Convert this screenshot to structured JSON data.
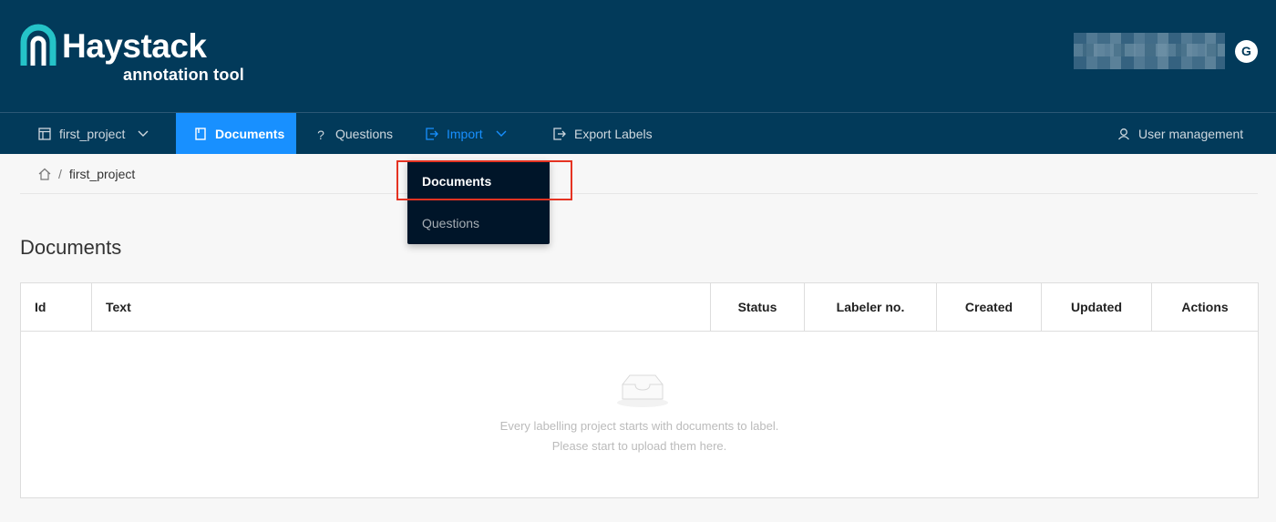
{
  "app": {
    "logo_title": "Haystack",
    "logo_subtitle": "annotation tool",
    "avatar_initial": "G",
    "brand_color": "#023a5a",
    "accent_color": "#1890ff"
  },
  "nav": {
    "project": "first_project",
    "documents": "Documents",
    "questions": "Questions",
    "import": "Import",
    "export_labels": "Export Labels",
    "user_management": "User management"
  },
  "import_menu": {
    "items": [
      {
        "label": "Documents",
        "icon": "none"
      },
      {
        "label": "Questions",
        "icon": "none"
      }
    ]
  },
  "breadcrumb": {
    "home_icon": "home-icon",
    "separator": "/",
    "current": "first_project"
  },
  "page": {
    "title": "Documents"
  },
  "table": {
    "columns": [
      "Id",
      "Text",
      "Status",
      "Labeler no.",
      "Created",
      "Updated",
      "Actions"
    ],
    "rows": [],
    "empty_line1": "Every labelling project starts with documents to label.",
    "empty_line2": "Please start to upload them here."
  }
}
